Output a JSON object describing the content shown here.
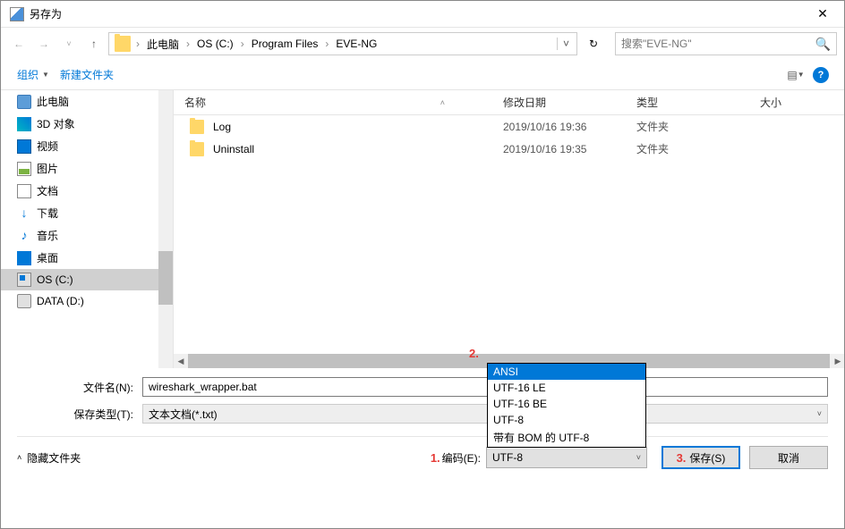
{
  "title": "另存为",
  "breadcrumb": [
    "此电脑",
    "OS (C:)",
    "Program Files",
    "EVE-NG"
  ],
  "search_placeholder": "搜索\"EVE-NG\"",
  "toolbar": {
    "organize": "组织",
    "newfolder": "新建文件夹"
  },
  "sidebar": [
    {
      "label": "此电脑",
      "icon": "icon-pc"
    },
    {
      "label": "3D 对象",
      "icon": "icon-3d"
    },
    {
      "label": "视频",
      "icon": "icon-video"
    },
    {
      "label": "图片",
      "icon": "icon-img"
    },
    {
      "label": "文档",
      "icon": "icon-doc"
    },
    {
      "label": "下载",
      "icon": "icon-dl",
      "glyph": "↓"
    },
    {
      "label": "音乐",
      "icon": "icon-music",
      "glyph": "♪"
    },
    {
      "label": "桌面",
      "icon": "icon-desk"
    },
    {
      "label": "OS (C:)",
      "icon": "icon-win",
      "selected": true
    },
    {
      "label": "DATA (D:)",
      "icon": "icon-drive"
    }
  ],
  "columns": {
    "name": "名称",
    "date": "修改日期",
    "type": "类型",
    "size": "大小"
  },
  "rows": [
    {
      "name": "Log",
      "date": "2019/10/16 19:36",
      "type": "文件夹"
    },
    {
      "name": "Uninstall",
      "date": "2019/10/16 19:35",
      "type": "文件夹"
    }
  ],
  "field": {
    "filename_label": "文件名(N):",
    "filename_value": "wireshark_wrapper.bat",
    "filetype_label": "保存类型(T):",
    "filetype_value": "文本文档(*.txt)"
  },
  "encoding": {
    "label": "编码(E):",
    "value": "UTF-8",
    "options": [
      "ANSI",
      "UTF-16 LE",
      "UTF-16 BE",
      "UTF-8",
      "带有 BOM 的 UTF-8"
    ]
  },
  "hide_folders": "隐藏文件夹",
  "buttons": {
    "save": "保存(S)",
    "cancel": "取消"
  },
  "annotations": {
    "a1": "1.",
    "a2": "2.",
    "a3": "3."
  }
}
